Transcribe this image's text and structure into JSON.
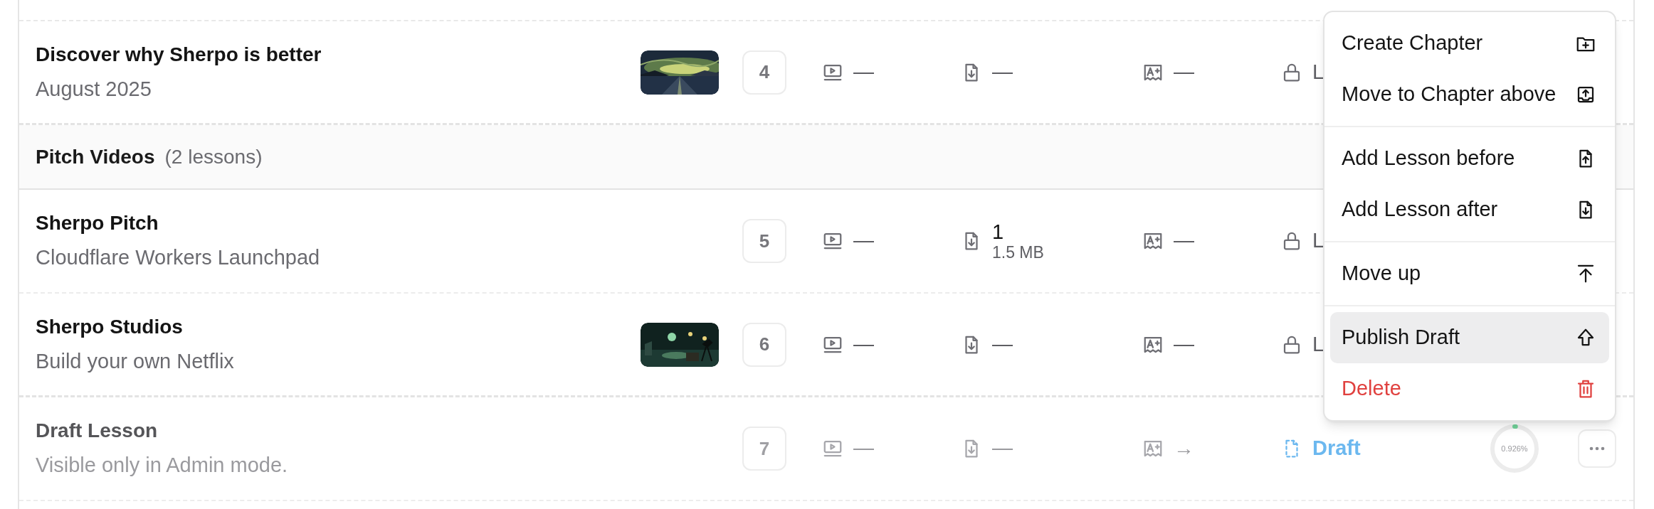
{
  "rows": [
    {
      "kind": "lesson",
      "title": "Discover why Sherpo is better",
      "subtitle": "August 2025",
      "number": "4",
      "video": "—",
      "attachments": "—",
      "quiz": "—",
      "status": {
        "kind": "locked",
        "label": "L"
      },
      "draft": false
    },
    {
      "kind": "chapter",
      "title": "Pitch Videos",
      "count": "(2 lessons)"
    },
    {
      "kind": "lesson",
      "title": "Sherpo Pitch",
      "subtitle": "Cloudflare Workers Launchpad",
      "number": "5",
      "video": "—",
      "attachments": "1",
      "attachments_size": "1.5 MB",
      "quiz": "—",
      "status": {
        "kind": "locked",
        "label": "L"
      },
      "draft": false
    },
    {
      "kind": "lesson",
      "title": "Sherpo Studios",
      "subtitle": "Build your own Netflix",
      "number": "6",
      "video": "—",
      "attachments": "—",
      "quiz": "—",
      "status": {
        "kind": "locked",
        "label": "L"
      },
      "draft": false
    },
    {
      "kind": "lesson",
      "title": "Draft Lesson",
      "subtitle": "Visible only in Admin mode.",
      "number": "7",
      "video": "—",
      "attachments": "—",
      "quiz": "→",
      "status": {
        "kind": "draft",
        "label": "Draft"
      },
      "draft": true,
      "progress": {
        "label": "0.926%",
        "level": 0.00926
      }
    }
  ],
  "menu": {
    "groups": [
      [
        {
          "label": "Create Chapter",
          "kind": "folder-plus",
          "selected": false,
          "destructive": false
        },
        {
          "label": "Move to Chapter above",
          "kind": "tray-up",
          "selected": false,
          "destructive": false
        }
      ],
      [
        {
          "label": "Add Lesson before",
          "kind": "file-up",
          "selected": false,
          "destructive": false
        },
        {
          "label": "Add Lesson after",
          "kind": "file-down",
          "selected": false,
          "destructive": false
        }
      ],
      [
        {
          "label": "Move up",
          "kind": "arrow-top",
          "selected": false,
          "destructive": false
        }
      ],
      [
        {
          "label": "Publish Draft",
          "kind": "arrow-outline-up",
          "selected": true,
          "destructive": false
        },
        {
          "label": "Delete",
          "kind": "trash",
          "selected": false,
          "destructive": true
        }
      ]
    ]
  }
}
